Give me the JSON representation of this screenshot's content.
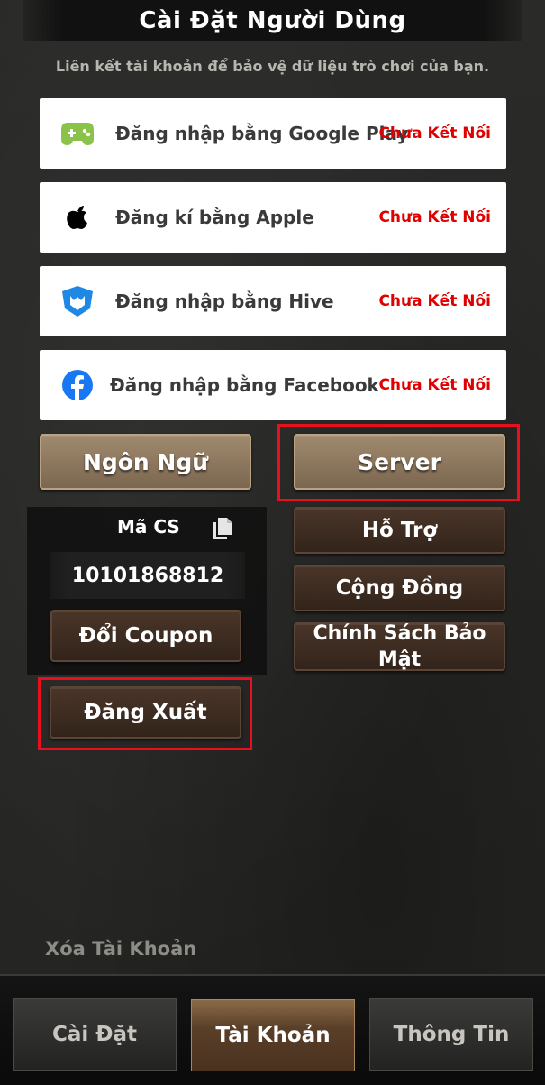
{
  "header": {
    "title": "Cài Đặt Người Dùng",
    "subtitle": "Liên kết tài khoản để bảo vệ dữ liệu trò chơi của bạn."
  },
  "links": [
    {
      "label": "Đăng nhập bằng Google Play",
      "status": "Chưa Kết Nối",
      "icon": "gamepad-icon",
      "color": "#8bc34a"
    },
    {
      "label": "Đăng kí bằng Apple",
      "status": "Chưa Kết Nối",
      "icon": "apple-icon",
      "color": "#000000"
    },
    {
      "label": "Đăng nhập bằng Hive",
      "status": "Chưa Kết Nối",
      "icon": "hive-shield-icon",
      "color": "#1e88e5"
    },
    {
      "label": "Đăng nhập bằng Facebook",
      "status": "Chưa Kết Nối",
      "icon": "facebook-icon",
      "color": "#1877f2"
    }
  ],
  "buttons": {
    "language": "Ngôn Ngữ",
    "server": "Server",
    "support": "Hỗ Trợ",
    "community": "Cộng Đồng",
    "privacy": "Chính Sách Bảo Mật",
    "coupon": "Đổi Coupon",
    "logout": "Đăng Xuất"
  },
  "cs": {
    "label": "Mã CS",
    "value": "10101868812"
  },
  "delete_account": "Xóa Tài Khoản",
  "tabs": [
    {
      "label": "Cài Đặt",
      "active": false
    },
    {
      "label": "Tài Khoản",
      "active": true
    },
    {
      "label": "Thông Tin",
      "active": false
    }
  ],
  "colors": {
    "status_red": "#e10000",
    "highlight_red": "#e8101e",
    "button_brown": "#3d2c21"
  }
}
